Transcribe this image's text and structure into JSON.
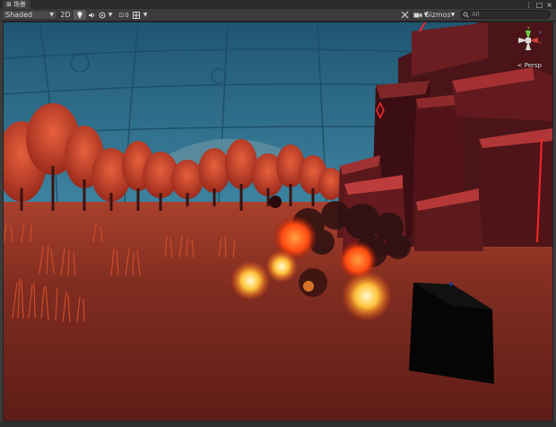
{
  "window": {
    "tab_icon": "scene-icon",
    "tab_title": "场景",
    "menu_glyph": "⋮",
    "max_glyph": "□",
    "close_glyph": "×"
  },
  "toolbar": {
    "shading_mode": "Shaded",
    "mode_2d": "2D",
    "effects_count": "0",
    "gizmos_label": "Gizmos",
    "search_placeholder": "All"
  },
  "scene": {
    "projection_label": "Persp",
    "axis_y": "y",
    "axis_z": "z",
    "axis_x": "x"
  },
  "colors": {
    "sky": "#2f6c86",
    "ground": "#7a2a1f",
    "fire": "#ffb030",
    "rock": "#6a1e22",
    "neon": "#ff2020"
  }
}
